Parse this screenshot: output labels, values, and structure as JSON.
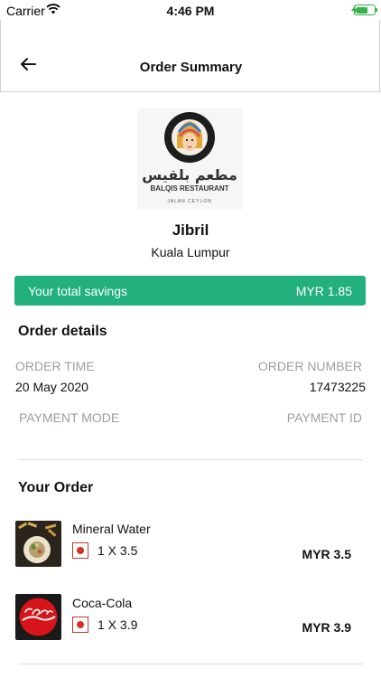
{
  "status_bar": {
    "carrier": "Carrier",
    "time": "4:46 PM",
    "battery_level": 0.7
  },
  "navbar": {
    "title": "Order Summary",
    "back_icon": "arrow-left-icon"
  },
  "restaurant": {
    "logo_arabic": "مطعم بلقيس",
    "logo_english": "BALQIS RESTAURANT",
    "logo_tagline": "JALAN CEYLON",
    "name": "Jibril",
    "location": "Kuala Lumpur"
  },
  "savings": {
    "label": "Your total savings",
    "value": "MYR 1.85",
    "color": "#22b07c"
  },
  "order_details": {
    "title": "Order details",
    "order_time_label": "ORDER TIME",
    "order_time_value": "20 May 2020",
    "order_number_label": "ORDER NUMBER",
    "order_number_value": "17473225",
    "payment_mode_label": "PAYMENT MODE",
    "payment_id_label": "PAYMENT ID"
  },
  "your_order": {
    "title": "Your Order",
    "items": [
      {
        "name": "Mineral Water",
        "qty": "1 X 3.5",
        "price": "MYR 3.5",
        "icon": "veg-indicator-icon"
      },
      {
        "name": "Coca-Cola",
        "qty": "1 X 3.9",
        "price": "MYR 3.9",
        "icon": "veg-indicator-icon"
      }
    ]
  }
}
